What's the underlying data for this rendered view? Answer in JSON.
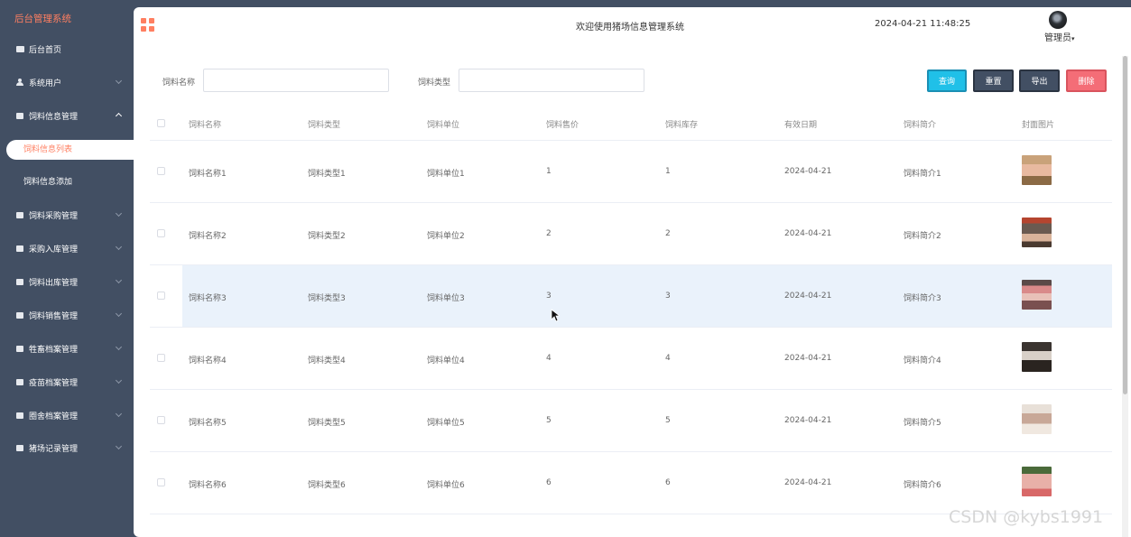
{
  "sidebar": {
    "brand": "后台管理系统",
    "items": [
      {
        "label": "后台首页",
        "icon": "monitor-icon",
        "has_arrow": false
      },
      {
        "label": "系统用户",
        "icon": "user-icon",
        "has_arrow": true
      },
      {
        "label": "饲料信息管理",
        "icon": "menu-square-icon",
        "has_arrow": true,
        "expanded": true
      },
      {
        "label": "饲料采购管理",
        "icon": "menu-square-icon",
        "has_arrow": true
      },
      {
        "label": "采购入库管理",
        "icon": "menu-square-icon",
        "has_arrow": true
      },
      {
        "label": "饲料出库管理",
        "icon": "menu-square-icon",
        "has_arrow": true
      },
      {
        "label": "饲料销售管理",
        "icon": "menu-square-icon",
        "has_arrow": true
      },
      {
        "label": "牲畜档案管理",
        "icon": "menu-square-icon",
        "has_arrow": true
      },
      {
        "label": "疫苗档案管理",
        "icon": "menu-square-icon",
        "has_arrow": true
      },
      {
        "label": "圈舍档案管理",
        "icon": "menu-square-icon",
        "has_arrow": true
      },
      {
        "label": "猪场记录管理",
        "icon": "menu-square-icon",
        "has_arrow": true
      }
    ],
    "submenu": [
      {
        "label": "饲料信息列表",
        "active": true
      },
      {
        "label": "饲料信息添加",
        "active": false
      }
    ]
  },
  "header": {
    "welcome": "欢迎使用猪场信息管理系统",
    "datetime": "2024-04-21 11:48:25",
    "user": "管理员"
  },
  "search": {
    "name_label": "饲料名称",
    "name_value": "",
    "type_label": "饲料类型",
    "type_value": ""
  },
  "buttons": {
    "query": "查询",
    "reset": "重置",
    "export": "导出",
    "delete": "删除"
  },
  "colors": {
    "accent": "#ff7f61",
    "sidebar_bg": "#424f63",
    "query_btn": "#20c0e8",
    "dark_btn": "#424f63",
    "delete_btn": "#f46d77",
    "row_highlight": "#eaf2fb"
  },
  "table": {
    "columns": [
      "饲料名称",
      "饲料类型",
      "饲料单位",
      "饲料售价",
      "饲料库存",
      "有效日期",
      "饲料简介",
      "封面图片"
    ],
    "rows": [
      {
        "name": "饲料名称1",
        "type": "饲料类型1",
        "unit": "饲料单位1",
        "price": "1",
        "stock": "1",
        "date": "2024-04-21",
        "intro": "饲料简介1",
        "cover": "pig-photo"
      },
      {
        "name": "饲料名称2",
        "type": "饲料类型2",
        "unit": "饲料单位2",
        "price": "2",
        "stock": "2",
        "date": "2024-04-21",
        "intro": "饲料简介2",
        "cover": "pig-photo"
      },
      {
        "name": "饲料名称3",
        "type": "饲料类型3",
        "unit": "饲料单位3",
        "price": "3",
        "stock": "3",
        "date": "2024-04-21",
        "intro": "饲料简介3",
        "cover": "pig-photo",
        "highlighted": true
      },
      {
        "name": "饲料名称4",
        "type": "饲料类型4",
        "unit": "饲料单位4",
        "price": "4",
        "stock": "4",
        "date": "2024-04-21",
        "intro": "饲料简介4",
        "cover": "pig-photo"
      },
      {
        "name": "饲料名称5",
        "type": "饲料类型5",
        "unit": "饲料单位5",
        "price": "5",
        "stock": "5",
        "date": "2024-04-21",
        "intro": "饲料简介5",
        "cover": "pig-photo"
      },
      {
        "name": "饲料名称6",
        "type": "饲料类型6",
        "unit": "饲料单位6",
        "price": "6",
        "stock": "6",
        "date": "2024-04-21",
        "intro": "饲料简介6",
        "cover": "pig-photo"
      }
    ]
  },
  "watermark": "CSDN @kybs1991"
}
